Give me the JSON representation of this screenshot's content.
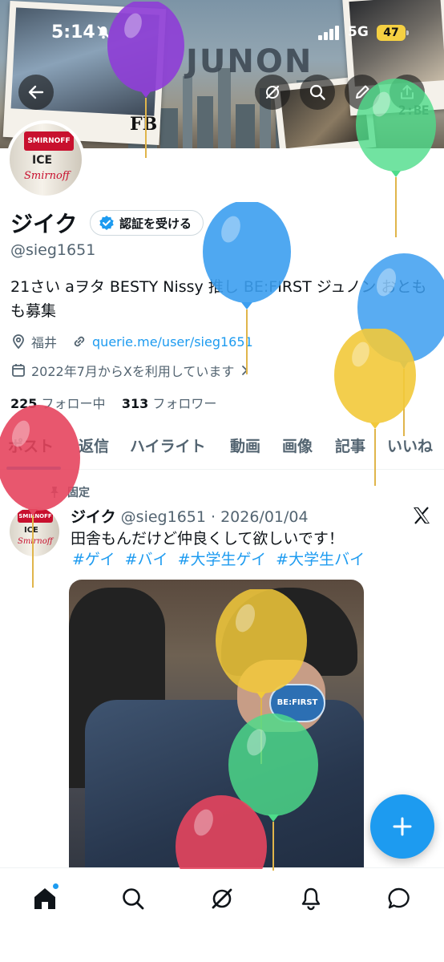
{
  "status_bar": {
    "time": "5:14",
    "network": "5G",
    "battery": "47"
  },
  "banner": {
    "title": "JUNON",
    "logo_left": "FB",
    "logo_right": "2:BE"
  },
  "profile": {
    "name": "ジイク",
    "verify_label": "認証を受ける",
    "handle": "@sieg1651",
    "bio": "21さい aヲタ BESTY Nissy 推し BE:FIRST ジュノン おともも募集",
    "location": "福井",
    "link": "querie.me/user/sieg1651",
    "joined": "2022年7月からXを利用しています",
    "following_count": "225",
    "following_label": "フォロー中",
    "followers_count": "313",
    "followers_label": "フォロワー",
    "avatar_can": {
      "brand": "SMIRNOFF",
      "flavor": "ICE",
      "script": "Smirnoff"
    }
  },
  "tabs": [
    "ポスト",
    "返信",
    "ハイライト",
    "動画",
    "画像",
    "記事",
    "いいね"
  ],
  "pinned_post": {
    "pinned_label": "固定",
    "author": "ジイク",
    "meta": "@sieg1651 · 2026/01/04",
    "text": "田舎もんだけど仲良くして欲しいです！",
    "hashtags": [
      "#ゲイ",
      "#バイ",
      "#大学生ゲイ",
      "#大学生バイ"
    ],
    "badge_text": "BE:FIRST"
  },
  "colors": {
    "accent": "#1d9bf0",
    "text": "#0f1419",
    "muted": "#536471",
    "verified": "#1d9bf0"
  },
  "nav": [
    "home-icon",
    "search-icon",
    "grok-icon",
    "notifications-icon",
    "messages-icon"
  ]
}
